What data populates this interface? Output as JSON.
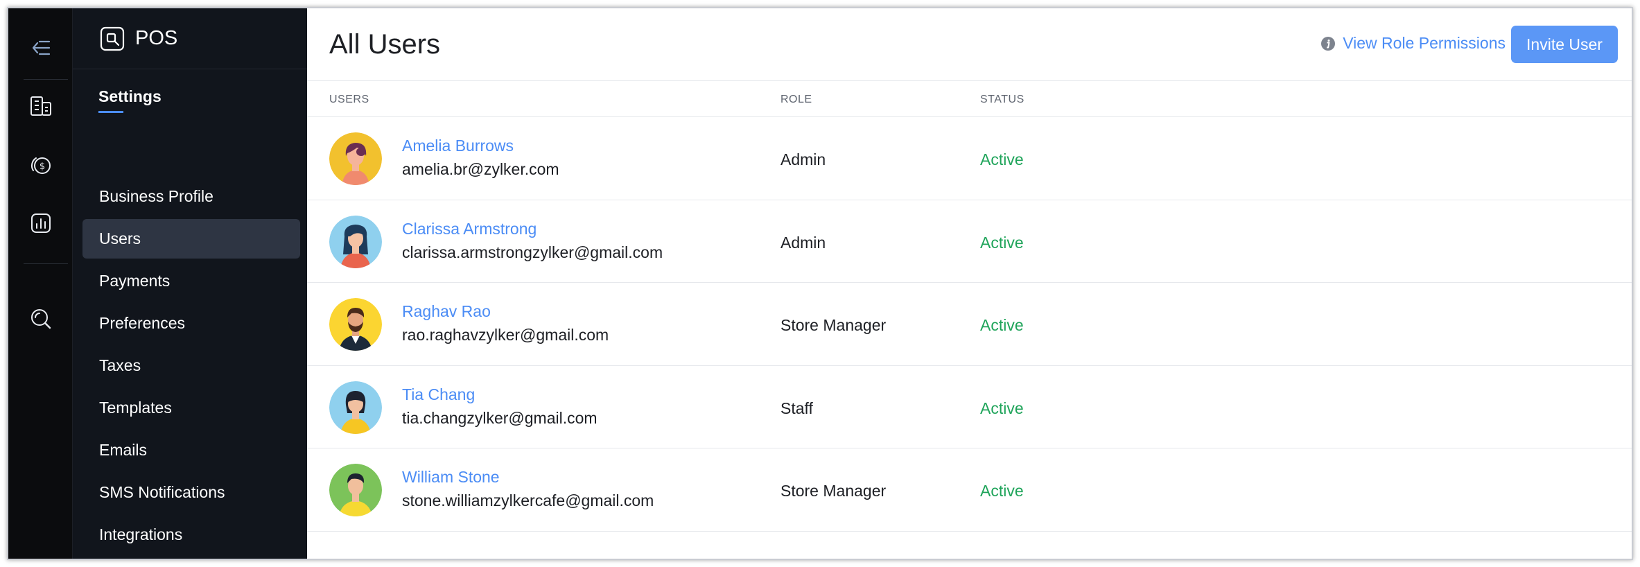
{
  "app": {
    "title": "POS"
  },
  "rail": {
    "items": [
      {
        "icon": "back-arrow-icon"
      },
      {
        "icon": "building-icon"
      },
      {
        "icon": "coin-icon"
      },
      {
        "icon": "report-icon"
      },
      {
        "icon": "search-icon"
      }
    ]
  },
  "sidebar": {
    "heading": "Settings",
    "items": [
      {
        "label": "Business Profile"
      },
      {
        "label": "Users",
        "active": true
      },
      {
        "label": "Payments"
      },
      {
        "label": "Preferences"
      },
      {
        "label": "Taxes"
      },
      {
        "label": "Templates"
      },
      {
        "label": "Emails"
      },
      {
        "label": "SMS Notifications"
      },
      {
        "label": "Integrations"
      }
    ]
  },
  "main": {
    "title": "All Users",
    "permissions_link": "View Role Permissions",
    "invite_button": "Invite User",
    "columns": {
      "users": "USERS",
      "role": "ROLE",
      "status": "STATUS"
    },
    "users": [
      {
        "name": "Amelia Burrows",
        "email": "amelia.br@zylker.com",
        "role": "Admin",
        "status": "Active",
        "avatar": "female-avatar-icon"
      },
      {
        "name": "Clarissa Armstrong",
        "email": "clarissa.armstrongzylker@gmail.com",
        "role": "Admin",
        "status": "Active",
        "avatar": "female-avatar-icon"
      },
      {
        "name": "Raghav Rao",
        "email": "rao.raghavzylker@gmail.com",
        "role": "Store Manager",
        "status": "Active",
        "avatar": "male-bearded-avatar-icon"
      },
      {
        "name": "Tia Chang",
        "email": "tia.changzylker@gmail.com",
        "role": "Staff",
        "status": "Active",
        "avatar": "female-avatar-icon"
      },
      {
        "name": "William Stone",
        "email": "stone.williamzylkercafe@gmail.com",
        "role": "Store Manager",
        "status": "Active",
        "avatar": "male-avatar-icon"
      }
    ]
  },
  "colors": {
    "accent": "#4b8cf5",
    "button": "#5b97f6",
    "status_active": "#1fa45a",
    "rail_bg": "#0b0c0e",
    "sidebar_bg": "#11151c"
  }
}
